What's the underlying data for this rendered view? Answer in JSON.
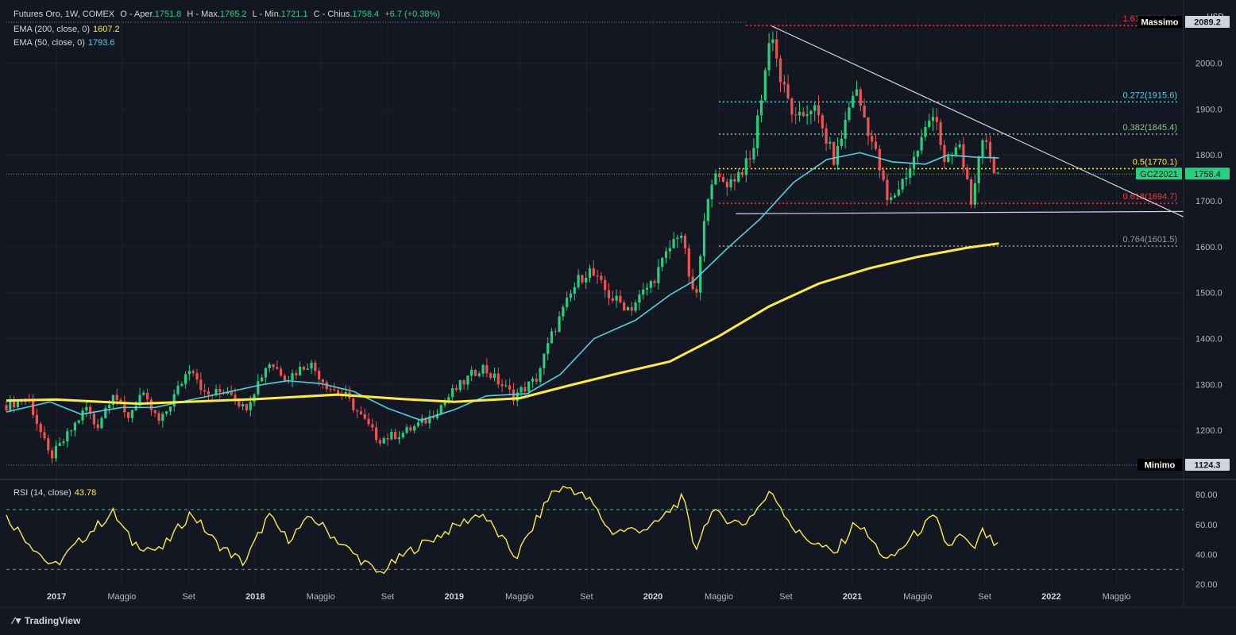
{
  "legend": {
    "title": "Futures Oro, 1W, COMEX",
    "open_label": "O - Aper.",
    "open": "1751.8",
    "high_label": "H - Max.",
    "high": "1765.2",
    "low_label": "L - Min.",
    "low": "1721.1",
    "close_label": "C - Chius.",
    "close": "1758.4",
    "change": "+6.7 (+0.38%)",
    "ema200_label": "EMA (200, close, 0)",
    "ema200": "1607.2",
    "ema50_label": "EMA (50, close, 0)",
    "ema50": "1793.6",
    "rsi_label": "RSI (14, close)",
    "rsi": "43.78"
  },
  "brand": "TradingView",
  "currency": "USD",
  "colors": {
    "bg": "#131722",
    "up": "#26d07c",
    "down": "#ef5350",
    "ema200": "#ffeb3b",
    "ema50": "#4dd0e1",
    "grid": "#1e222d",
    "axis": "#2a2e39",
    "text": "#b2b5be"
  },
  "chart_data": {
    "type": "candlestick",
    "x_range": [
      "2016-10-01",
      "2022-09-01"
    ],
    "y_range": [
      1100,
      2110
    ],
    "x_ticks": [
      {
        "date": "2017-01-01",
        "label": "2017",
        "bold": true
      },
      {
        "date": "2017-05-01",
        "label": "Maggio"
      },
      {
        "date": "2017-09-01",
        "label": "Set"
      },
      {
        "date": "2018-01-01",
        "label": "2018",
        "bold": true
      },
      {
        "date": "2018-05-01",
        "label": "Maggio"
      },
      {
        "date": "2018-09-01",
        "label": "Set"
      },
      {
        "date": "2019-01-01",
        "label": "2019",
        "bold": true
      },
      {
        "date": "2019-05-01",
        "label": "Maggio"
      },
      {
        "date": "2019-09-01",
        "label": "Set"
      },
      {
        "date": "2020-01-01",
        "label": "2020",
        "bold": true
      },
      {
        "date": "2020-05-01",
        "label": "Maggio"
      },
      {
        "date": "2020-09-01",
        "label": "Set"
      },
      {
        "date": "2021-01-01",
        "label": "2021",
        "bold": true
      },
      {
        "date": "2021-05-01",
        "label": "Maggio"
      },
      {
        "date": "2021-09-01",
        "label": "Set"
      },
      {
        "date": "2022-01-01",
        "label": "2022",
        "bold": true
      },
      {
        "date": "2022-05-01",
        "label": "Maggio"
      }
    ],
    "y_ticks": [
      "1200.0",
      "1300.0",
      "1400.0",
      "1500.0",
      "1600.0",
      "1700.0",
      "1800.0",
      "1900.0",
      "2000.0"
    ],
    "price_path": [
      [
        "2016-10-01",
        1255
      ],
      [
        "2016-11-10",
        1270
      ],
      [
        "2016-12-20",
        1140
      ],
      [
        "2017-01-10",
        1170
      ],
      [
        "2017-02-25",
        1250
      ],
      [
        "2017-03-15",
        1205
      ],
      [
        "2017-04-15",
        1285
      ],
      [
        "2017-05-10",
        1225
      ],
      [
        "2017-06-05",
        1280
      ],
      [
        "2017-07-10",
        1215
      ],
      [
        "2017-09-05",
        1345
      ],
      [
        "2017-10-01",
        1275
      ],
      [
        "2017-11-15",
        1290
      ],
      [
        "2017-12-12",
        1245
      ],
      [
        "2018-01-25",
        1350
      ],
      [
        "2018-03-01",
        1315
      ],
      [
        "2018-04-10",
        1348
      ],
      [
        "2018-05-15",
        1295
      ],
      [
        "2018-06-15",
        1275
      ],
      [
        "2018-08-15",
        1180
      ],
      [
        "2018-10-01",
        1195
      ],
      [
        "2018-11-15",
        1225
      ],
      [
        "2018-12-31",
        1285
      ],
      [
        "2019-02-20",
        1340
      ],
      [
        "2019-04-20",
        1275
      ],
      [
        "2019-05-31",
        1310
      ],
      [
        "2019-06-30",
        1410
      ],
      [
        "2019-08-15",
        1525
      ],
      [
        "2019-09-05",
        1550
      ],
      [
        "2019-10-15",
        1490
      ],
      [
        "2019-11-20",
        1465
      ],
      [
        "2019-12-31",
        1525
      ],
      [
        "2020-02-20",
        1640
      ],
      [
        "2020-03-18",
        1470
      ],
      [
        "2020-04-14",
        1750
      ],
      [
        "2020-05-20",
        1740
      ],
      [
        "2020-06-30",
        1790
      ],
      [
        "2020-08-06",
        2080
      ],
      [
        "2020-08-20",
        1970
      ],
      [
        "2020-09-20",
        1870
      ],
      [
        "2020-10-20",
        1910
      ],
      [
        "2020-11-30",
        1785
      ],
      [
        "2021-01-05",
        1950
      ],
      [
        "2021-02-15",
        1795
      ],
      [
        "2021-03-08",
        1690
      ],
      [
        "2021-04-20",
        1780
      ],
      [
        "2021-06-01",
        1905
      ],
      [
        "2021-06-20",
        1770
      ],
      [
        "2021-07-15",
        1825
      ],
      [
        "2021-08-10",
        1690
      ],
      [
        "2021-08-25",
        1815
      ],
      [
        "2021-09-05",
        1835
      ],
      [
        "2021-09-20",
        1755
      ],
      [
        "2021-09-27",
        1758
      ]
    ],
    "ema50_path": [
      [
        "2016-10-01",
        1240
      ],
      [
        "2016-12-20",
        1262
      ],
      [
        "2017-02-15",
        1235
      ],
      [
        "2017-05-01",
        1250
      ],
      [
        "2017-07-01",
        1250
      ],
      [
        "2017-09-10",
        1268
      ],
      [
        "2017-11-10",
        1283
      ],
      [
        "2018-01-15",
        1300
      ],
      [
        "2018-03-01",
        1308
      ],
      [
        "2018-05-01",
        1302
      ],
      [
        "2018-06-30",
        1285
      ],
      [
        "2018-09-01",
        1248
      ],
      [
        "2018-11-01",
        1222
      ],
      [
        "2019-01-01",
        1245
      ],
      [
        "2019-03-01",
        1275
      ],
      [
        "2019-05-15",
        1280
      ],
      [
        "2019-07-15",
        1322
      ],
      [
        "2019-09-15",
        1400
      ],
      [
        "2019-11-30",
        1440
      ],
      [
        "2020-02-01",
        1495
      ],
      [
        "2020-03-15",
        1525
      ],
      [
        "2020-05-15",
        1595
      ],
      [
        "2020-07-15",
        1660
      ],
      [
        "2020-09-15",
        1740
      ],
      [
        "2020-11-15",
        1790
      ],
      [
        "2021-01-15",
        1805
      ],
      [
        "2021-03-15",
        1785
      ],
      [
        "2021-05-15",
        1780
      ],
      [
        "2021-06-25",
        1800
      ],
      [
        "2021-08-15",
        1795
      ],
      [
        "2021-09-27",
        1793.6
      ]
    ],
    "ema200_path": [
      [
        "2016-10-01",
        1265
      ],
      [
        "2017-01-01",
        1267
      ],
      [
        "2017-06-01",
        1258
      ],
      [
        "2018-01-01",
        1268
      ],
      [
        "2018-06-01",
        1278
      ],
      [
        "2018-10-01",
        1268
      ],
      [
        "2019-01-01",
        1262
      ],
      [
        "2019-05-01",
        1270
      ],
      [
        "2019-08-01",
        1298
      ],
      [
        "2019-11-01",
        1325
      ],
      [
        "2020-02-01",
        1350
      ],
      [
        "2020-05-01",
        1405
      ],
      [
        "2020-08-01",
        1470
      ],
      [
        "2020-11-01",
        1520
      ],
      [
        "2021-02-01",
        1553
      ],
      [
        "2021-05-01",
        1578
      ],
      [
        "2021-08-01",
        1598
      ],
      [
        "2021-09-27",
        1607.2
      ]
    ],
    "fib_levels": [
      {
        "label": "1.618(2081.9)",
        "value": 2081.9,
        "color": "#f23645"
      },
      {
        "label": "0.272(1915.6)",
        "value": 1915.6,
        "color": "#4dd0e1"
      },
      {
        "label": "0.382(1845.4)",
        "value": 1845.4,
        "color": "#81c784"
      },
      {
        "label": "0.5(1770.1)",
        "value": 1770.1,
        "color": "#ffeb3b"
      },
      {
        "label": "0.618(1694.7)",
        "value": 1694.7,
        "color": "#f23645"
      },
      {
        "label": "0.764(1601.5)",
        "value": 1601.5,
        "color": "#9598a1"
      }
    ],
    "trendlines": [
      {
        "from": [
          "2020-08-06",
          2081
        ],
        "to": [
          "2022-09-01",
          1665
        ]
      },
      {
        "from": [
          "2020-06-01",
          1672
        ],
        "to": [
          "2022-09-01",
          1677
        ]
      }
    ],
    "labels": {
      "max_label": "Massimo",
      "max_value": "2089.2",
      "min_label": "Minimo",
      "min_value": "1124.3",
      "symbol": "GCZ2021",
      "last": "1758.4"
    },
    "min_value_line": 1124.3,
    "last_price_line": 1758.4,
    "rsi": {
      "y_range": [
        18,
        88
      ],
      "y_ticks": [
        "80.00",
        "60.00",
        "40.00",
        "20.00"
      ],
      "upper": 70,
      "lower": 30,
      "path": [
        [
          "2016-10-01",
          65
        ],
        [
          "2016-11-20",
          45
        ],
        [
          "2016-12-25",
          31
        ],
        [
          "2017-02-25",
          53
        ],
        [
          "2017-04-15",
          68
        ],
        [
          "2017-05-20",
          48
        ],
        [
          "2017-07-10",
          42
        ],
        [
          "2017-09-05",
          68
        ],
        [
          "2017-10-20",
          48
        ],
        [
          "2017-12-12",
          34
        ],
        [
          "2018-01-25",
          66
        ],
        [
          "2018-03-01",
          50
        ],
        [
          "2018-04-15",
          65
        ],
        [
          "2018-06-15",
          45
        ],
        [
          "2018-08-15",
          27
        ],
        [
          "2018-10-10",
          42
        ],
        [
          "2018-12-31",
          58
        ],
        [
          "2019-02-20",
          68
        ],
        [
          "2019-04-25",
          38
        ],
        [
          "2019-06-30",
          82
        ],
        [
          "2019-08-01",
          85
        ],
        [
          "2019-09-10",
          75
        ],
        [
          "2019-10-15",
          55
        ],
        [
          "2019-12-31",
          58
        ],
        [
          "2020-02-25",
          78
        ],
        [
          "2020-03-18",
          43
        ],
        [
          "2020-04-15",
          68
        ],
        [
          "2020-06-15",
          60
        ],
        [
          "2020-08-06",
          82
        ],
        [
          "2020-09-20",
          55
        ],
        [
          "2020-11-30",
          40
        ],
        [
          "2021-01-08",
          62
        ],
        [
          "2021-03-08",
          35
        ],
        [
          "2021-04-30",
          55
        ],
        [
          "2021-06-01",
          65
        ],
        [
          "2021-06-25",
          45
        ],
        [
          "2021-07-20",
          53
        ],
        [
          "2021-08-10",
          42
        ],
        [
          "2021-08-28",
          55
        ],
        [
          "2021-09-27",
          43.78
        ]
      ]
    }
  }
}
